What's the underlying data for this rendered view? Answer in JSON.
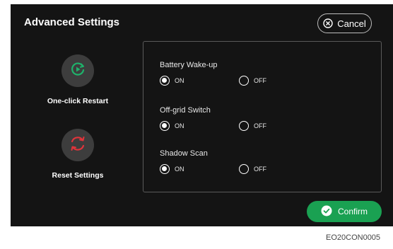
{
  "dialog": {
    "title": "Advanced Settings",
    "cancel_label": "Cancel",
    "confirm_label": "Confirm"
  },
  "actions": [
    {
      "label": "One-click Restart",
      "icon": "play-restart-icon",
      "color": "#1fb26b"
    },
    {
      "label": "Reset Settings",
      "icon": "reset-arrows-icon",
      "color": "#e0343b"
    }
  ],
  "settings": [
    {
      "title": "Battery Wake-up",
      "on_label": "ON",
      "off_label": "OFF",
      "selected": "ON"
    },
    {
      "title": "Off-grid Switch",
      "on_label": "ON",
      "off_label": "OFF",
      "selected": "ON"
    },
    {
      "title": "Shadow Scan",
      "on_label": "ON",
      "off_label": "OFF",
      "selected": "ON"
    }
  ],
  "figure_code": "EO20CON0005",
  "colors": {
    "background": "#141414",
    "accent_green": "#1aa152",
    "reset_red": "#e0343b"
  }
}
